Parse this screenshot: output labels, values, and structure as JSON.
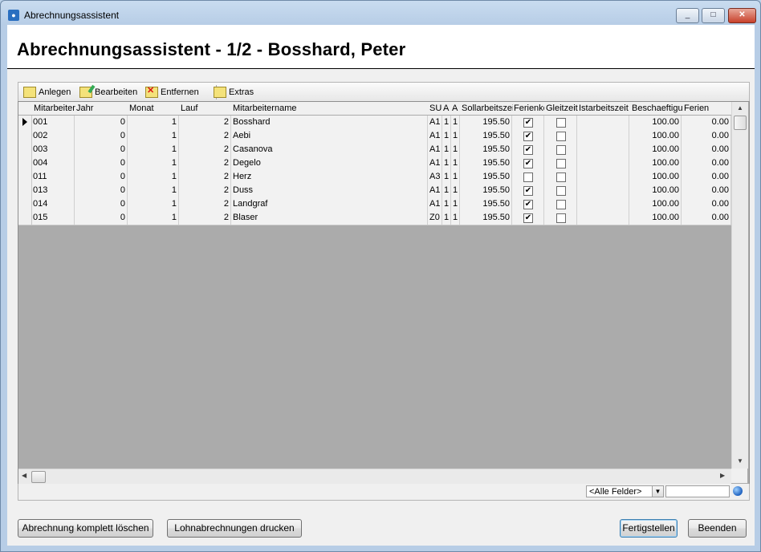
{
  "window": {
    "title": "Abrechnungsassistent",
    "min": "_",
    "max": "□",
    "close": "✕"
  },
  "page_title": "Abrechnungsassistent - 1/2 - Bosshard, Peter",
  "toolbar": {
    "new": "Anlegen",
    "edit": "Bearbeiten",
    "delete": "Entfernen",
    "extras": "Extras"
  },
  "columns": [
    "Mitarbeiter",
    "Jahr",
    "Monat",
    "Lauf",
    "Mitarbeitername",
    "SU",
    "A",
    "A",
    "Sollarbeitszei",
    "Ferienkö",
    "Gleitzeit",
    "Istarbeitszeit",
    "Beschaeftigu",
    "Ferien"
  ],
  "rows": [
    {
      "id": "001",
      "jahr": "0",
      "monat": "1",
      "lauf": "2",
      "name": "Bosshard",
      "su": "A1",
      "a1": "1",
      "a2": "1",
      "soll": "195.50",
      "ferien_chk": true,
      "gleit_chk": false,
      "ist": "",
      "besch": "100.00",
      "ferien": "0.00"
    },
    {
      "id": "002",
      "jahr": "0",
      "monat": "1",
      "lauf": "2",
      "name": "Aebi",
      "su": "A1",
      "a1": "1",
      "a2": "1",
      "soll": "195.50",
      "ferien_chk": true,
      "gleit_chk": false,
      "ist": "",
      "besch": "100.00",
      "ferien": "0.00"
    },
    {
      "id": "003",
      "jahr": "0",
      "monat": "1",
      "lauf": "2",
      "name": "Casanova",
      "su": "A1",
      "a1": "1",
      "a2": "1",
      "soll": "195.50",
      "ferien_chk": true,
      "gleit_chk": false,
      "ist": "",
      "besch": "100.00",
      "ferien": "0.00"
    },
    {
      "id": "004",
      "jahr": "0",
      "monat": "1",
      "lauf": "2",
      "name": "Degelo",
      "su": "A1",
      "a1": "1",
      "a2": "1",
      "soll": "195.50",
      "ferien_chk": true,
      "gleit_chk": false,
      "ist": "",
      "besch": "100.00",
      "ferien": "0.00"
    },
    {
      "id": "011",
      "jahr": "0",
      "monat": "1",
      "lauf": "2",
      "name": "Herz",
      "su": "A3",
      "a1": "1",
      "a2": "1",
      "soll": "195.50",
      "ferien_chk": false,
      "gleit_chk": false,
      "ist": "",
      "besch": "100.00",
      "ferien": "0.00"
    },
    {
      "id": "013",
      "jahr": "0",
      "monat": "1",
      "lauf": "2",
      "name": "Duss",
      "su": "A1",
      "a1": "1",
      "a2": "1",
      "soll": "195.50",
      "ferien_chk": true,
      "gleit_chk": false,
      "ist": "",
      "besch": "100.00",
      "ferien": "0.00"
    },
    {
      "id": "014",
      "jahr": "0",
      "monat": "1",
      "lauf": "2",
      "name": "Landgraf",
      "su": "A1",
      "a1": "1",
      "a2": "1",
      "soll": "195.50",
      "ferien_chk": true,
      "gleit_chk": false,
      "ist": "",
      "besch": "100.00",
      "ferien": "0.00"
    },
    {
      "id": "015",
      "jahr": "0",
      "monat": "1",
      "lauf": "2",
      "name": "Blaser",
      "su": "Z0",
      "a1": "1",
      "a2": "1",
      "soll": "195.50",
      "ferien_chk": true,
      "gleit_chk": false,
      "ist": "",
      "besch": "100.00",
      "ferien": "0.00"
    }
  ],
  "filter": {
    "selected": "<Alle Felder>",
    "value": ""
  },
  "buttons": {
    "delete_all": "Abrechnung komplett löschen",
    "print": "Lohnabrechnungen drucken",
    "finish": "Fertigstellen",
    "quit": "Beenden"
  },
  "icons": {
    "app": "app-icon",
    "globe": "globe-icon",
    "check": "✔"
  },
  "colors": {
    "title_bg": "#bcd2ea",
    "grid_bg": "#ababab",
    "accent": "#3c7fb1"
  }
}
